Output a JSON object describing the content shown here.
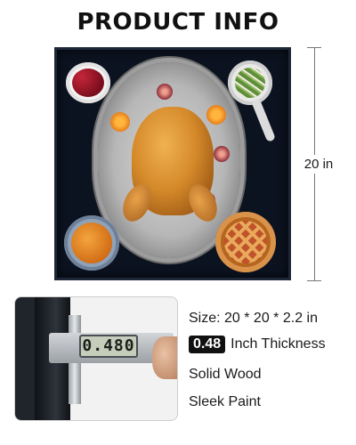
{
  "title": "PRODUCT INFO",
  "dimension_label": "20 in",
  "caliper_reading": "0.480",
  "specs": {
    "size": "Size: 20 * 20 * 2.2 in",
    "thickness_value": "0.48",
    "thickness_label": "Inch Thickness",
    "material": "Solid Wood",
    "finish": "Sleek Paint"
  },
  "colors": {
    "tray": "#0c1320",
    "badge": "#111111",
    "text": "#1a1a1a"
  }
}
